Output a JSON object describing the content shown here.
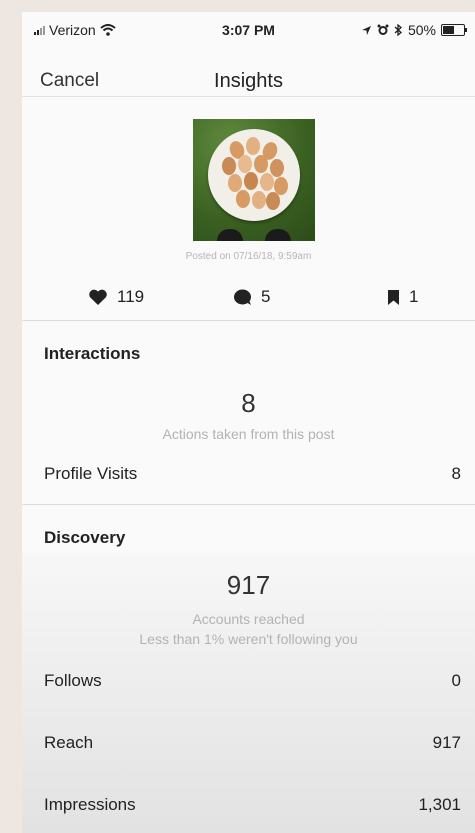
{
  "status_bar": {
    "carrier": "Verizon",
    "time": "3:07 PM",
    "battery": "50%"
  },
  "nav": {
    "cancel_label": "Cancel",
    "title": "Insights"
  },
  "post": {
    "posted_on": "Posted on 07/16/18, 9:59am",
    "likes": "119",
    "comments": "5",
    "saves": "1"
  },
  "interactions": {
    "title": "Interactions",
    "total": "8",
    "total_caption": "Actions taken from this post",
    "rows": [
      {
        "label": "Profile Visits",
        "value": "8"
      }
    ]
  },
  "discovery": {
    "title": "Discovery",
    "reached": "917",
    "reached_caption": "Accounts reached",
    "following_note": "Less than 1% weren't following you",
    "rows": [
      {
        "label": "Follows",
        "value": "0"
      },
      {
        "label": "Reach",
        "value": "917"
      },
      {
        "label": "Impressions",
        "value": "1,301"
      }
    ]
  },
  "colors": {
    "background": "#ede6e1",
    "screen": "#fafafa",
    "muted_text": "#b3b3b3",
    "photo_grass": "#3a6021",
    "egg": "#d69a62"
  }
}
